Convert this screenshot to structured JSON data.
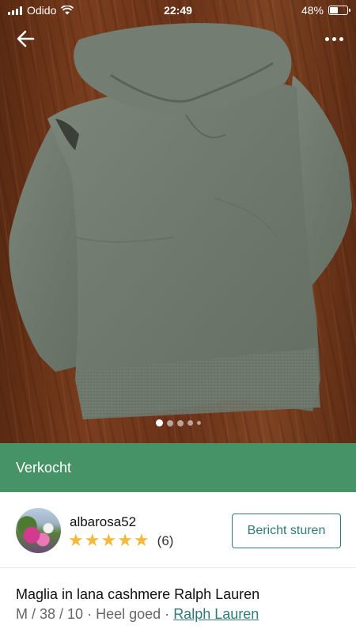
{
  "status_bar": {
    "carrier": "Odido",
    "time": "22:49",
    "battery_percent": "48%",
    "battery_level": 0.48,
    "signal_icon": "signal-icon",
    "wifi_icon": "wifi-icon",
    "battery_icon": "battery-icon"
  },
  "nav": {
    "back_icon": "arrow-left-icon",
    "more_icon": "more-horizontal-icon"
  },
  "gallery": {
    "photo_count": 5,
    "active_index": 0,
    "background_color": "#6a3219",
    "item_color": "#707a6e"
  },
  "banner": {
    "label": "Verkocht",
    "color": "#459367"
  },
  "seller": {
    "username": "albarosa52",
    "rating_stars": 5,
    "review_count": "(6)",
    "message_button": "Bericht sturen",
    "accent_color": "#2f7a76",
    "star_color": "#f2b93b"
  },
  "item": {
    "title": "Maglia in lana cashmere Ralph Lauren",
    "size": "M / 38 / 10",
    "separator": "·",
    "condition": "Heel goed",
    "brand": "Ralph Lauren"
  }
}
